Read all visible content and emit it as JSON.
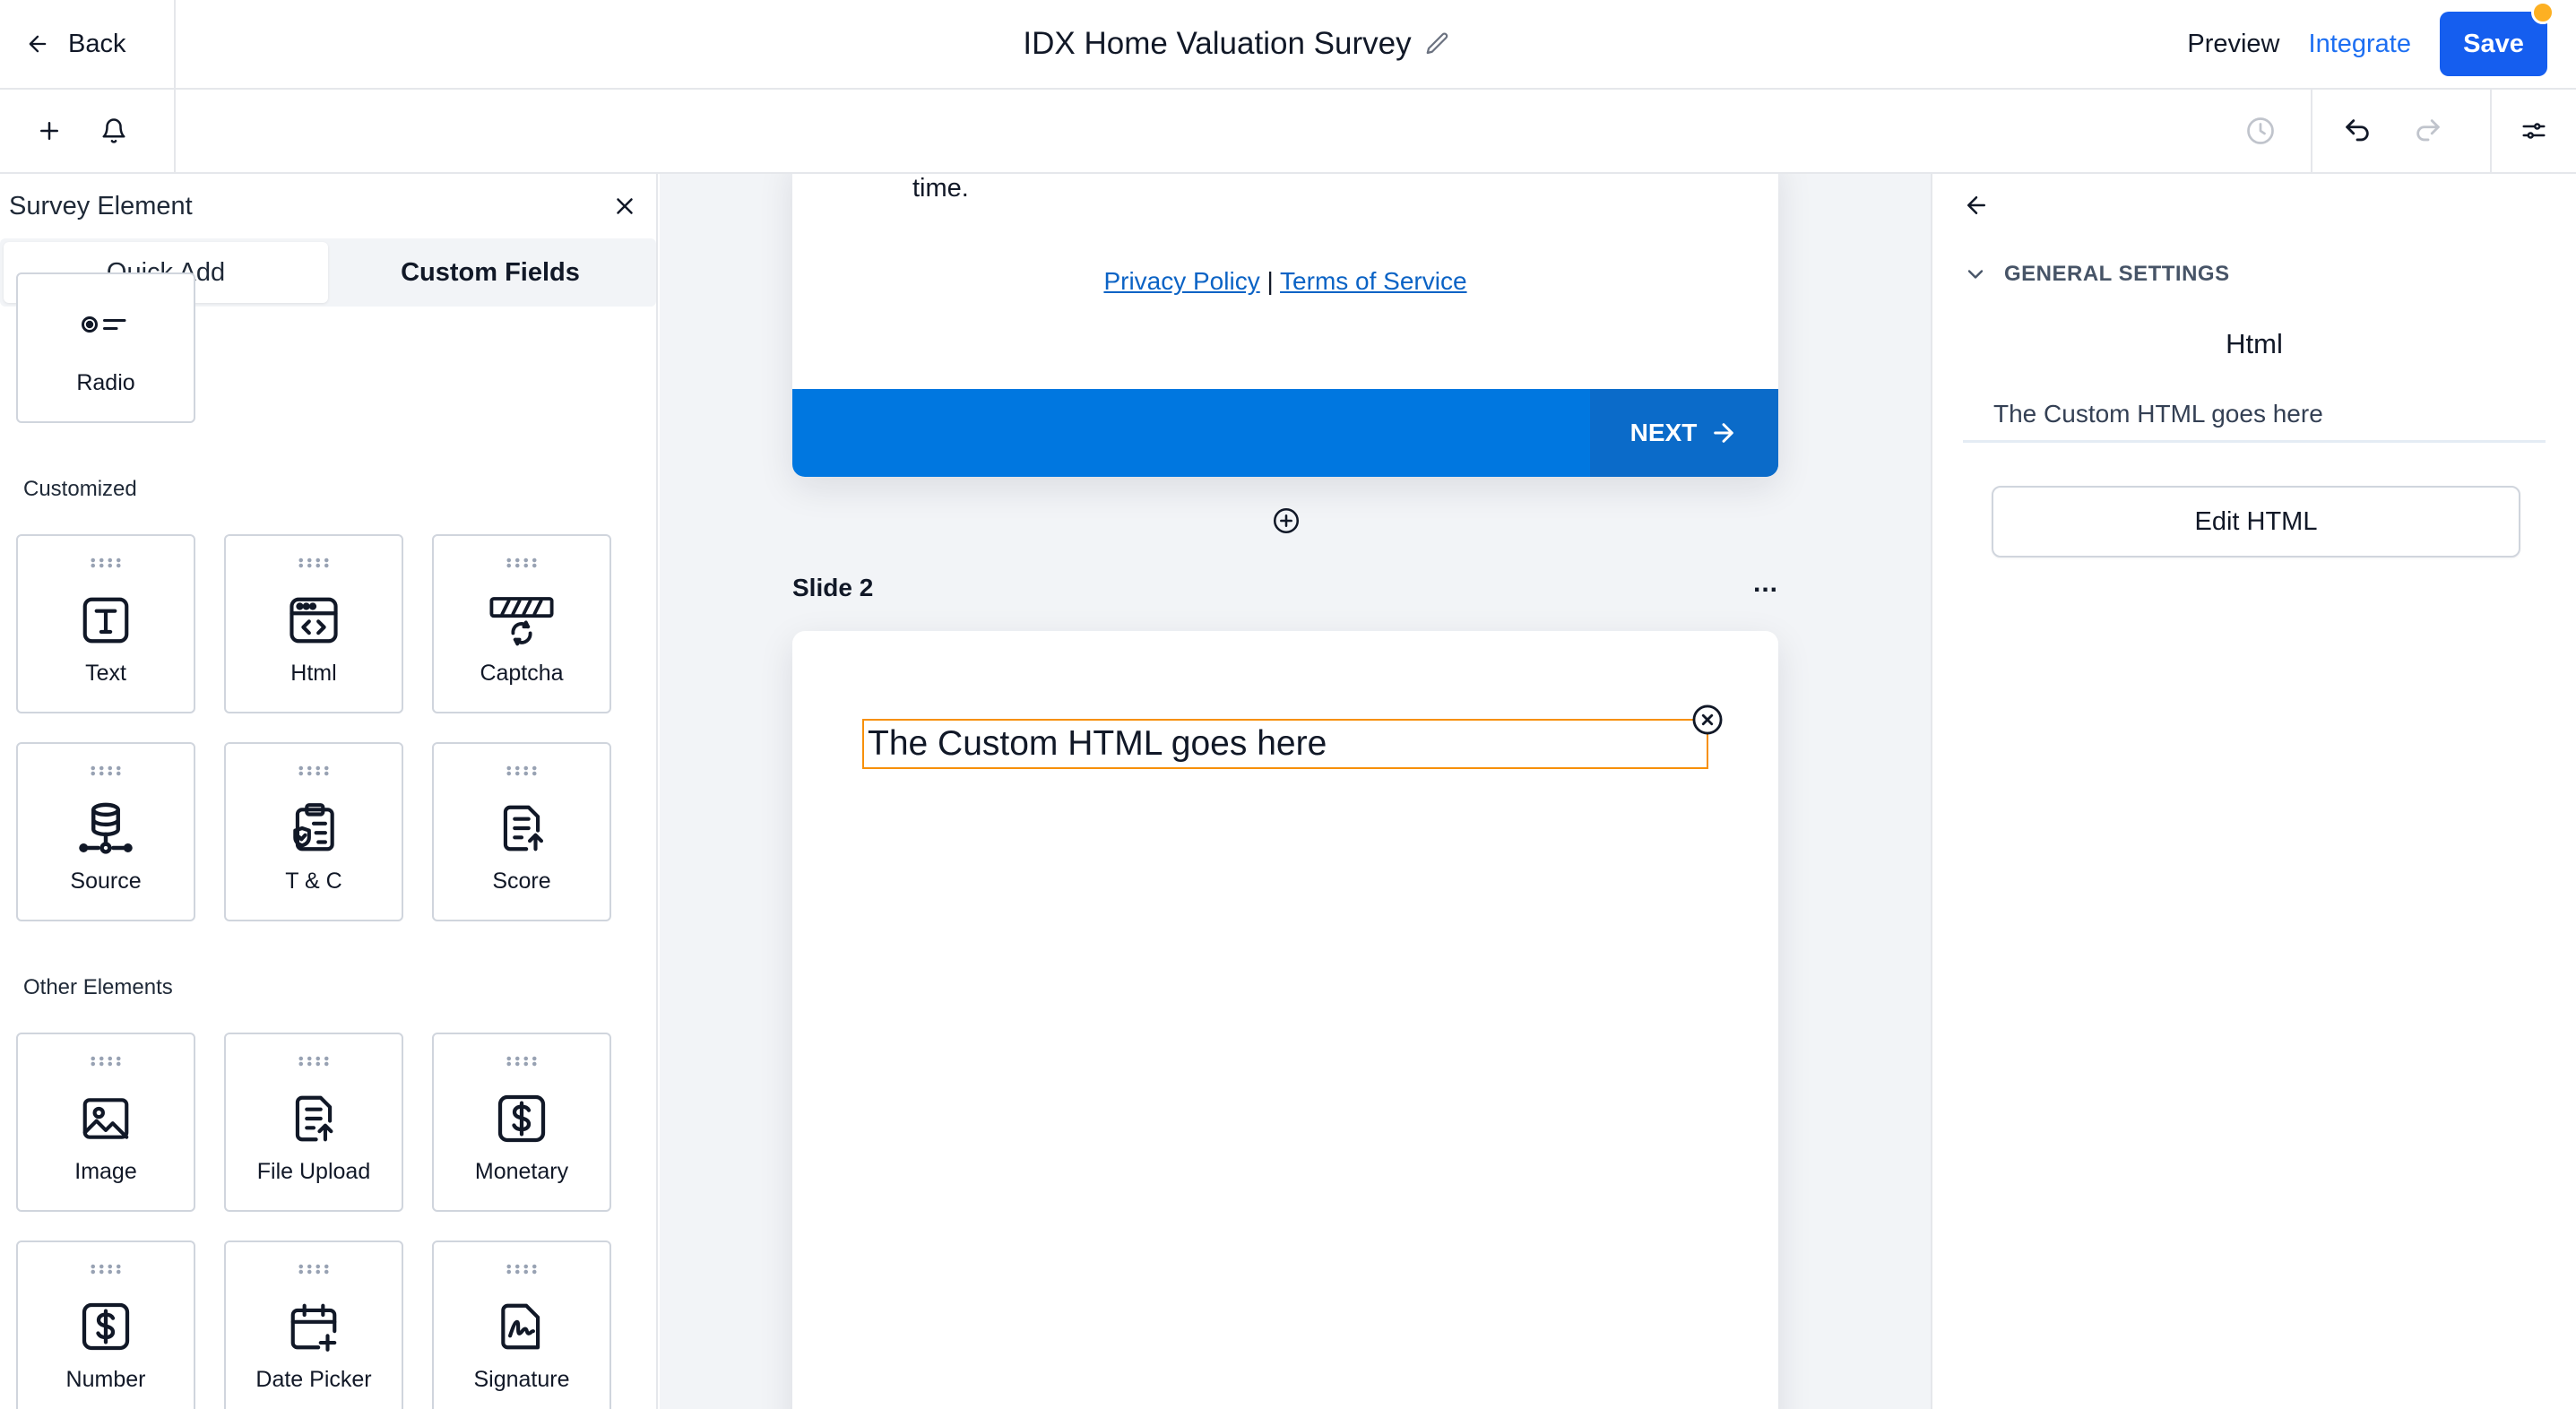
{
  "header": {
    "back_label": "Back",
    "title": "IDX Home Valuation Survey",
    "preview_label": "Preview",
    "integrate_label": "Integrate",
    "save_label": "Save"
  },
  "colors": {
    "accent": "#155eef",
    "link": "#1d6ff2",
    "next_bar": "#0077e0",
    "selection_outline": "#f79009",
    "notification_dot": "#fdb022"
  },
  "toolbar": {
    "left_icons": [
      "plus-icon",
      "bell-icon"
    ],
    "right_icons": [
      "history-icon",
      "undo-icon",
      "redo-icon",
      "settings-sliders-icon"
    ]
  },
  "sidebar": {
    "title": "Survey Element",
    "tabs": [
      {
        "label": "Quick Add",
        "active": true
      },
      {
        "label": "Custom Fields",
        "active": false
      }
    ],
    "partial_item": {
      "label": "Radio",
      "icon": "radio-icon"
    },
    "sections": [
      {
        "title": "Customized",
        "items": [
          {
            "label": "Text",
            "icon": "text-icon"
          },
          {
            "label": "Html",
            "icon": "html-icon"
          },
          {
            "label": "Captcha",
            "icon": "captcha-icon"
          },
          {
            "label": "Source",
            "icon": "source-icon"
          },
          {
            "label": "T & C",
            "icon": "terms-icon"
          },
          {
            "label": "Score",
            "icon": "score-icon"
          }
        ]
      },
      {
        "title": "Other Elements",
        "items": [
          {
            "label": "Image",
            "icon": "image-icon"
          },
          {
            "label": "File Upload",
            "icon": "file-upload-icon"
          },
          {
            "label": "Monetary",
            "icon": "monetary-icon"
          },
          {
            "label": "Number",
            "icon": "number-icon"
          },
          {
            "label": "Date Picker",
            "icon": "date-picker-icon"
          },
          {
            "label": "Signature",
            "icon": "signature-icon"
          }
        ]
      }
    ]
  },
  "canvas": {
    "slide1": {
      "trailing_text": "time.",
      "privacy_label": "Privacy Policy",
      "separator": "|",
      "terms_label": "Terms of Service",
      "next_label": "NEXT"
    },
    "slide2": {
      "label": "Slide 2",
      "menu": "...",
      "html_content": "The Custom HTML goes here"
    }
  },
  "right_panel": {
    "section_title": "GENERAL SETTINGS",
    "element_title": "Html",
    "content_preview": "The Custom HTML goes here",
    "edit_button_label": "Edit HTML"
  }
}
